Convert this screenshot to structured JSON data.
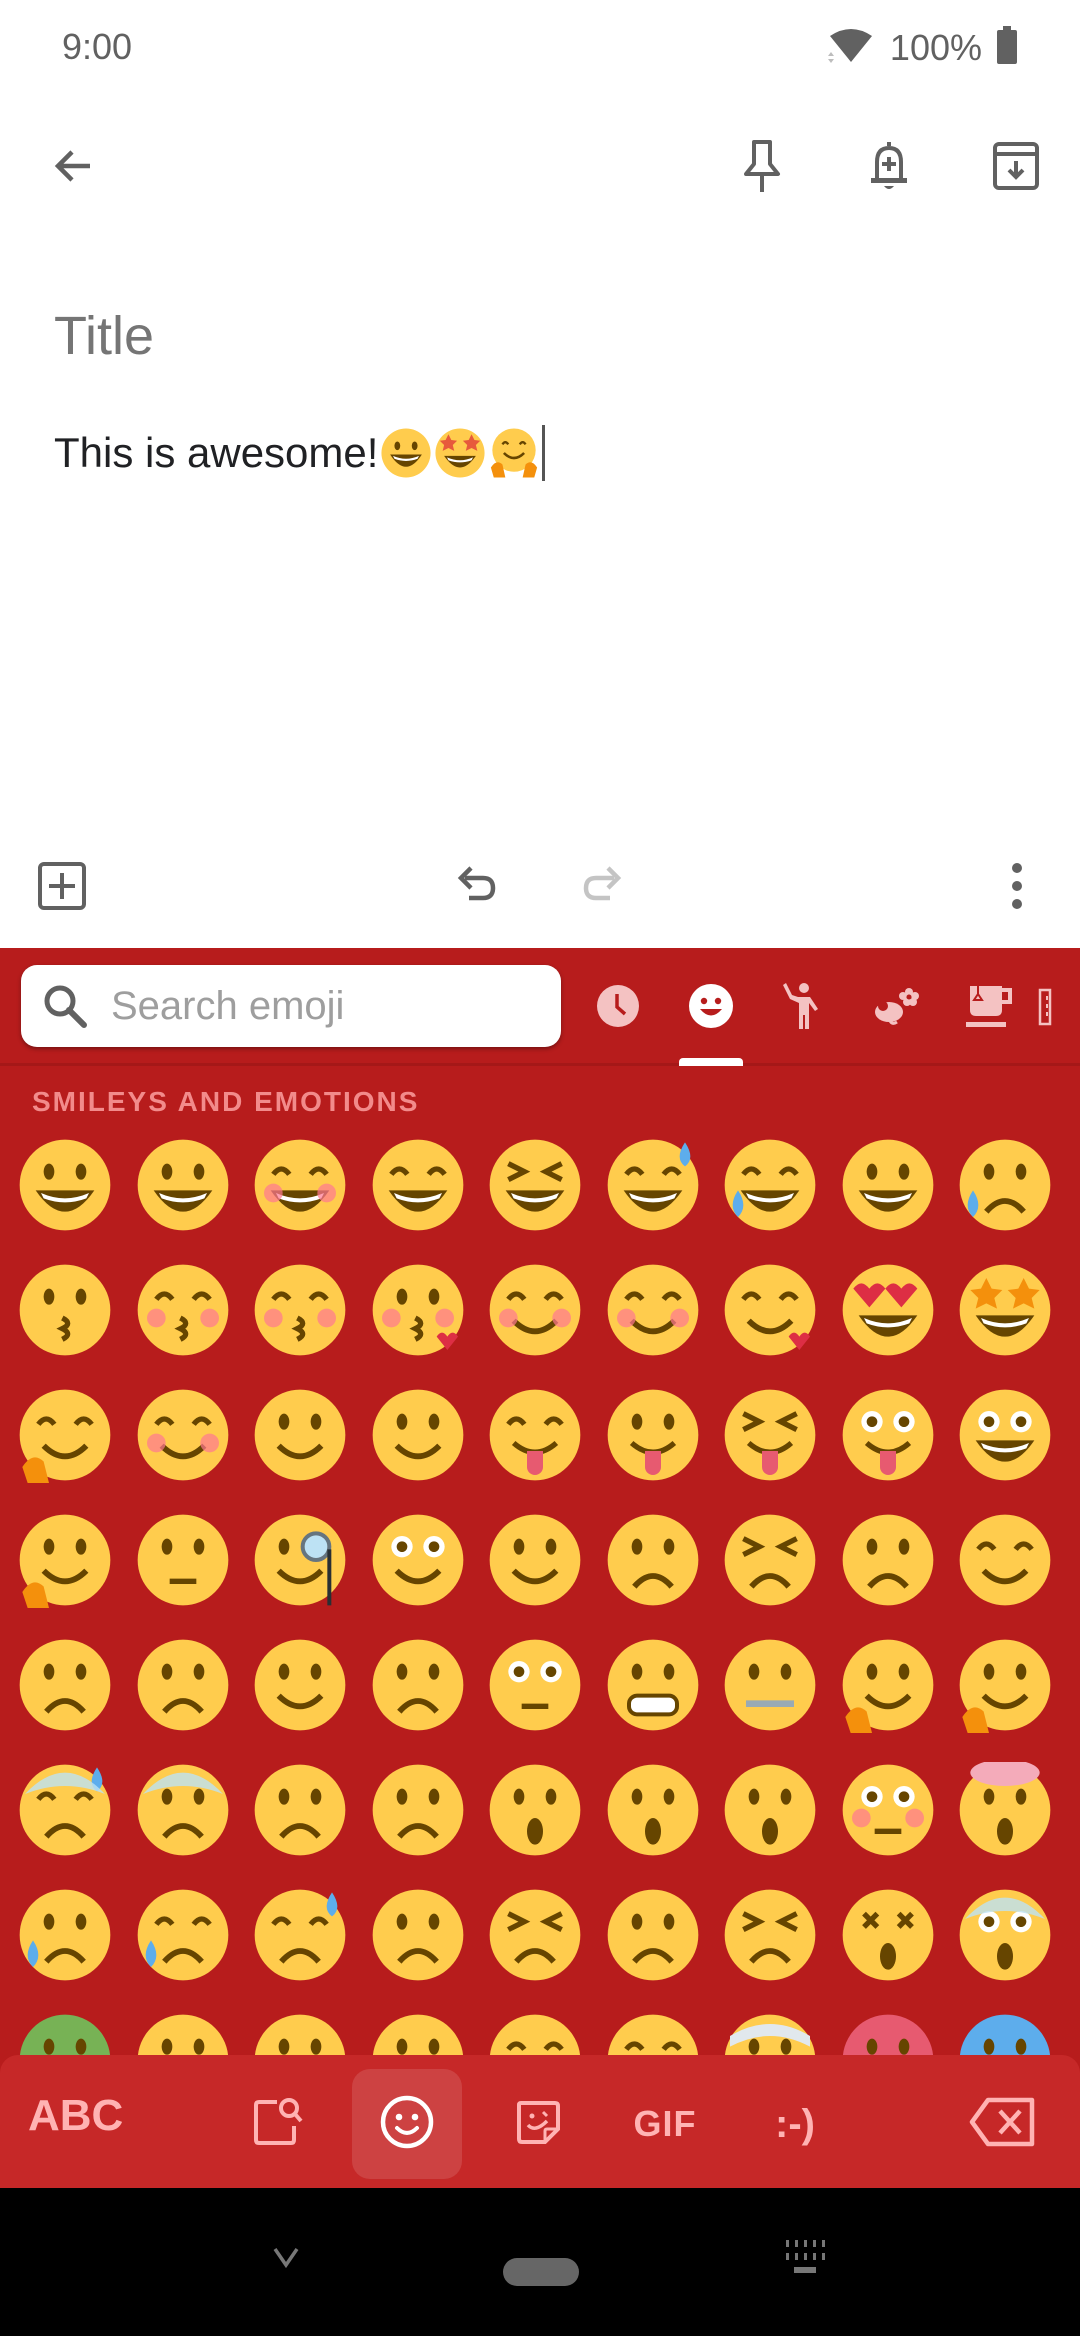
{
  "status_bar": {
    "time": "9:00",
    "battery_percent": "100%",
    "icons": [
      "wifi-icon",
      "battery-icon"
    ]
  },
  "app_bar": {
    "actions": [
      {
        "name": "back",
        "icon": "arrow-left-icon"
      },
      {
        "name": "pin",
        "icon": "pin-icon"
      },
      {
        "name": "reminder",
        "icon": "bell-plus-icon"
      },
      {
        "name": "archive",
        "icon": "archive-icon"
      }
    ]
  },
  "note": {
    "title_placeholder": "Title",
    "title_value": "",
    "body_text": "This is awesome!",
    "body_emoji": [
      "grinning-face",
      "star-struck",
      "hugging-face"
    ]
  },
  "editor_toolbar": {
    "actions": [
      {
        "name": "add",
        "icon": "add-box-icon"
      },
      {
        "name": "undo",
        "icon": "undo-icon",
        "enabled": true
      },
      {
        "name": "redo",
        "icon": "redo-icon",
        "enabled": false
      },
      {
        "name": "more",
        "icon": "more-vert-icon"
      }
    ]
  },
  "keyboard": {
    "colors": {
      "background": "#b71c1c",
      "bottom_bar": "#c62828",
      "accent": "#ffb3b3",
      "emoji_yellow": "#ffcc4d"
    },
    "search": {
      "placeholder": "Search emoji",
      "value": ""
    },
    "category_tabs": [
      {
        "name": "recent",
        "icon": "clock-icon",
        "selected": false
      },
      {
        "name": "smileys",
        "icon": "smiley-icon",
        "selected": true
      },
      {
        "name": "people",
        "icon": "person-waving-icon",
        "selected": false
      },
      {
        "name": "animals-nature",
        "icon": "bee-flower-icon",
        "selected": false
      },
      {
        "name": "food-drink",
        "icon": "cup-icon",
        "selected": false
      },
      {
        "name": "travel",
        "icon": "building-icon",
        "selected": false
      }
    ],
    "section_label": "SMILEYS AND EMOTIONS",
    "emoji_rows": [
      [
        "grinning-face",
        "grinning-face-big-eyes",
        "grinning-face-smiling-eyes",
        "beaming-face",
        "grinning-squinting-face",
        "grinning-face-sweat",
        "face-tears-of-joy",
        "rolling-on-floor-laughing",
        "loudly-crying-face"
      ],
      [
        "kissing-face",
        "kissing-face-smiling-eyes",
        "kissing-face-closed-eyes",
        "face-blowing-kiss",
        "smiling-face",
        "smiling-face-smiling-eyes",
        "smiling-face-hearts",
        "heart-eyes",
        "star-struck"
      ],
      [
        "hugging-face",
        "slightly-smiling-face",
        "upside-down-face",
        "winking-face",
        "face-savoring-food",
        "face-with-tongue",
        "squinting-face-tongue",
        "winking-face-tongue",
        "zany-face"
      ],
      [
        "thinking-face",
        "face-raised-eyebrow",
        "face-with-monocle",
        "face-rolling-eyes",
        "smirking-face",
        "unamused-face",
        "persevering-face",
        "pensive-face",
        "relieved-face"
      ],
      [
        "frowning-face",
        "slightly-frowning-face",
        "confused-face",
        "worried-face",
        "pleading-face",
        "grimacing-face",
        "zipper-mouth-face",
        "shushing-face",
        "face-hand-over-mouth"
      ],
      [
        "anxious-face-sweat",
        "fearful-face",
        "frowning-open-mouth",
        "anguished-face",
        "face-open-mouth",
        "hushed-face",
        "astonished-face",
        "flushed-face",
        "exploding-head"
      ],
      [
        "crying-face",
        "sad-relieved-face",
        "downcast-face-sweat",
        "disappointed-face",
        "confounded-face",
        "weary-face",
        "tired-face",
        "dizzy-face",
        "face-screaming-fear"
      ],
      [
        "nauseated-face",
        "angry-face",
        "pouting-face",
        "face-steam-nose",
        "sleepy-face",
        "sleeping-face",
        "face-head-bandage",
        "hot-face",
        "cold-face"
      ]
    ],
    "bottom_bar": {
      "abc_label": "ABC",
      "gif_label": "GIF",
      "emoticon_label": ":-)",
      "buttons": [
        {
          "name": "abc",
          "selected": false
        },
        {
          "name": "emoji-search",
          "icon": "sticker-search-icon",
          "selected": false
        },
        {
          "name": "emoji",
          "icon": "smiley-icon",
          "selected": true
        },
        {
          "name": "sticker",
          "icon": "sticker-icon",
          "selected": false
        },
        {
          "name": "gif",
          "selected": false
        },
        {
          "name": "emoticon",
          "selected": false
        },
        {
          "name": "delete",
          "icon": "backspace-icon"
        }
      ]
    }
  },
  "nav_bar": {
    "buttons": [
      {
        "name": "hide-keyboard",
        "icon": "chevron-down-icon"
      },
      {
        "name": "home",
        "icon": "home-pill-icon"
      },
      {
        "name": "switch-input",
        "icon": "keyboard-icon"
      }
    ]
  }
}
